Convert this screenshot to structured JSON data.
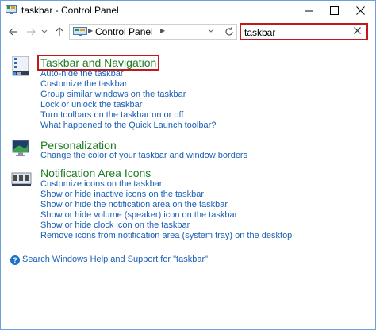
{
  "window": {
    "title": "taskbar - Control Panel",
    "icons": {
      "app": "control-panel-icon",
      "minimize": "minimize-icon",
      "maximize": "maximize-icon",
      "close": "close-icon"
    }
  },
  "address_bar": {
    "nav": {
      "back": "back-arrow-icon",
      "forward": "forward-arrow-icon",
      "recent": "chevron-down-icon",
      "up": "up-arrow-icon"
    },
    "location_icon": "control-panel-icon",
    "location": "Control Panel",
    "refresh_icon": "refresh-icon",
    "search": {
      "value": "taskbar",
      "clear_icon": "close-icon"
    }
  },
  "results": [
    {
      "title": "Taskbar and Navigation",
      "icon": "taskbar-icon",
      "highlighted": true,
      "links": [
        "Auto-hide the taskbar",
        "Customize the taskbar",
        "Group similar windows on the taskbar",
        "Lock or unlock the taskbar",
        "Turn toolbars on the taskbar on or off",
        "What happened to the Quick Launch toolbar?"
      ]
    },
    {
      "title": "Personalization",
      "icon": "personalization-icon",
      "highlighted": false,
      "links": [
        "Change the color of your taskbar and window borders"
      ]
    },
    {
      "title": "Notification Area Icons",
      "icon": "notification-area-icon",
      "highlighted": false,
      "links": [
        "Customize icons on the taskbar",
        "Show or hide inactive icons on the taskbar",
        "Show or hide the notification area on the taskbar",
        "Show or hide volume (speaker) icon on the taskbar",
        "Show or hide clock icon on the taskbar",
        "Remove icons from notification area (system tray) on the desktop"
      ]
    }
  ],
  "help": {
    "icon": "help-icon",
    "text": "Search Windows Help and Support for \"taskbar\""
  }
}
